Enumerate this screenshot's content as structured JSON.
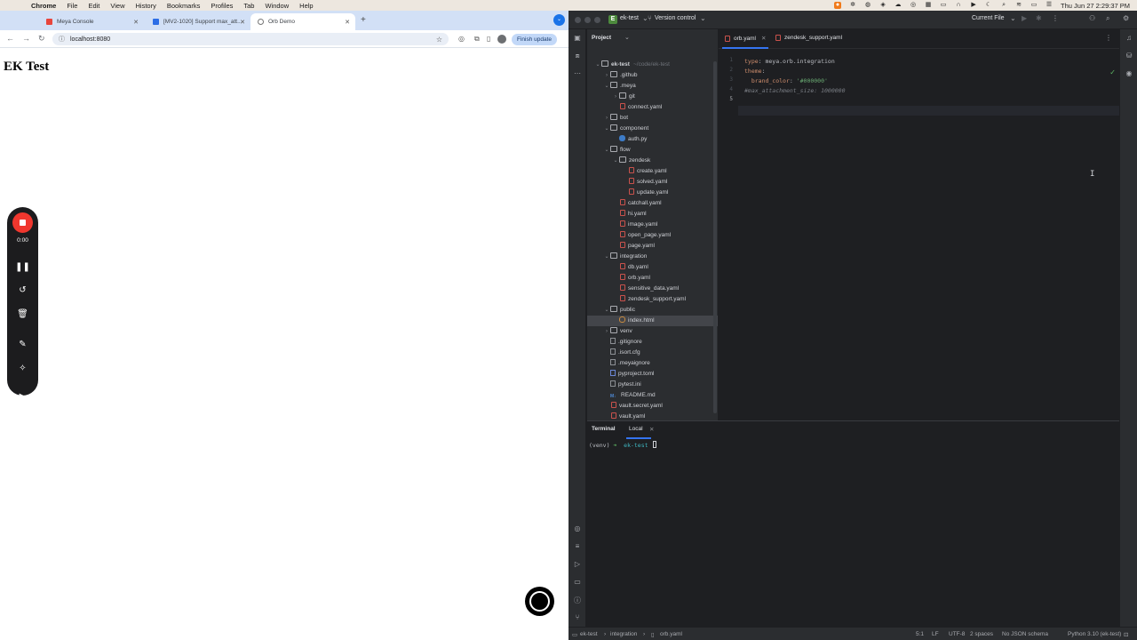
{
  "menubar": {
    "app": "Chrome",
    "items": [
      "File",
      "Edit",
      "View",
      "History",
      "Bookmarks",
      "Profiles",
      "Tab",
      "Window",
      "Help"
    ],
    "clock": "Thu Jun 27  2:29:37 PM"
  },
  "browser": {
    "tabs": [
      {
        "title": "Meya Console"
      },
      {
        "title": "[MV2-1020] Support max_att..."
      },
      {
        "title": "Orb Demo"
      }
    ],
    "url": "localhost:8080",
    "finish_update": "Finish update",
    "page_heading": "EK Test"
  },
  "recorder": {
    "timer": "0:00"
  },
  "ide": {
    "project_name": "ek-test",
    "vcs": "Version control",
    "run_config": "Current File",
    "panel_title": "Project",
    "tree": [
      {
        "label": "ek-test",
        "suffix": "~/code/ek-test",
        "depth": 0,
        "type": "folder",
        "arrow": "v"
      },
      {
        "label": ".github",
        "depth": 1,
        "type": "folder",
        "arrow": ">"
      },
      {
        "label": ".meya",
        "depth": 1,
        "type": "folder",
        "arrow": "v"
      },
      {
        "label": "git",
        "depth": 2,
        "type": "folder",
        "arrow": ">"
      },
      {
        "label": "connect.yaml",
        "depth": 2,
        "type": "yaml",
        "arrow": ""
      },
      {
        "label": "bot",
        "depth": 1,
        "type": "folder",
        "arrow": ">"
      },
      {
        "label": "component",
        "depth": 1,
        "type": "folder",
        "arrow": "v"
      },
      {
        "label": "auth.py",
        "depth": 2,
        "type": "py",
        "arrow": ""
      },
      {
        "label": "flow",
        "depth": 1,
        "type": "folder",
        "arrow": "v"
      },
      {
        "label": "zendesk",
        "depth": 2,
        "type": "folder",
        "arrow": "v"
      },
      {
        "label": "create.yaml",
        "depth": 3,
        "type": "yaml",
        "arrow": ""
      },
      {
        "label": "solved.yaml",
        "depth": 3,
        "type": "yaml",
        "arrow": ""
      },
      {
        "label": "update.yaml",
        "depth": 3,
        "type": "yaml",
        "arrow": ""
      },
      {
        "label": "catchall.yaml",
        "depth": 2,
        "type": "yaml",
        "arrow": ""
      },
      {
        "label": "hi.yaml",
        "depth": 2,
        "type": "yaml",
        "arrow": ""
      },
      {
        "label": "image.yaml",
        "depth": 2,
        "type": "yaml",
        "arrow": ""
      },
      {
        "label": "open_page.yaml",
        "depth": 2,
        "type": "yaml",
        "arrow": ""
      },
      {
        "label": "page.yaml",
        "depth": 2,
        "type": "yaml",
        "arrow": ""
      },
      {
        "label": "integration",
        "depth": 1,
        "type": "folder",
        "arrow": "v"
      },
      {
        "label": "db.yaml",
        "depth": 2,
        "type": "yaml",
        "arrow": ""
      },
      {
        "label": "orb.yaml",
        "depth": 2,
        "type": "yaml",
        "arrow": ""
      },
      {
        "label": "sensitive_data.yaml",
        "depth": 2,
        "type": "yaml",
        "arrow": ""
      },
      {
        "label": "zendesk_support.yaml",
        "depth": 2,
        "type": "yaml",
        "arrow": ""
      },
      {
        "label": "public",
        "depth": 1,
        "type": "folder",
        "arrow": "v"
      },
      {
        "label": "index.html",
        "depth": 2,
        "type": "html",
        "arrow": "",
        "selected": true
      },
      {
        "label": "venv",
        "depth": 1,
        "type": "folder",
        "arrow": ">"
      },
      {
        "label": ".gitignore",
        "depth": 1,
        "type": "cfg",
        "arrow": ""
      },
      {
        "label": ".isort.cfg",
        "depth": 1,
        "type": "cfg",
        "arrow": ""
      },
      {
        "label": ".meyaignore",
        "depth": 1,
        "type": "cfg",
        "arrow": ""
      },
      {
        "label": "pyproject.toml",
        "depth": 1,
        "type": "toml",
        "arrow": ""
      },
      {
        "label": "pytest.ini",
        "depth": 1,
        "type": "cfg",
        "arrow": ""
      },
      {
        "label": "README.md",
        "depth": 1,
        "type": "md",
        "arrow": ""
      },
      {
        "label": "vault.secret.yaml",
        "depth": 1,
        "type": "yaml",
        "arrow": ""
      },
      {
        "label": "vault.yaml",
        "depth": 1,
        "type": "yaml",
        "arrow": ""
      },
      {
        "label": "External Libraries",
        "depth": 0,
        "type": "lib",
        "arrow": ">"
      }
    ],
    "editor_tabs": [
      {
        "label": "orb.yaml"
      },
      {
        "label": "zendesk_support.yaml"
      }
    ],
    "code_lines": [
      {
        "num": "1",
        "parts": [
          {
            "c": "k",
            "t": "type"
          },
          {
            "c": "v",
            "t": ": meya.orb.integration"
          }
        ]
      },
      {
        "num": "2",
        "parts": [
          {
            "c": "k",
            "t": "theme"
          },
          {
            "c": "v",
            "t": ":"
          }
        ]
      },
      {
        "num": "3",
        "parts": [
          {
            "c": "k",
            "t": "  brand_color"
          },
          {
            "c": "v",
            "t": ": "
          },
          {
            "c": "s",
            "t": "'#000000'"
          }
        ]
      },
      {
        "num": "4",
        "parts": [
          {
            "c": "c",
            "t": "#max_attachment_size: 1000000"
          }
        ]
      },
      {
        "num": "5",
        "parts": []
      }
    ],
    "terminal": {
      "title": "Terminal",
      "tab": "Local",
      "prompt_env": "(venv)",
      "prompt_arrow": "➜",
      "prompt_dir": "ek-test"
    },
    "status": {
      "crumb_project": "ek-test",
      "crumb_folder": "integration",
      "crumb_file": "orb.yaml",
      "position": "5:1",
      "line_sep": "LF",
      "encoding": "UTF-8",
      "indent": "2 spaces",
      "schema": "No JSON schema",
      "interpreter": "Python 3.10 (ek-test)"
    }
  }
}
